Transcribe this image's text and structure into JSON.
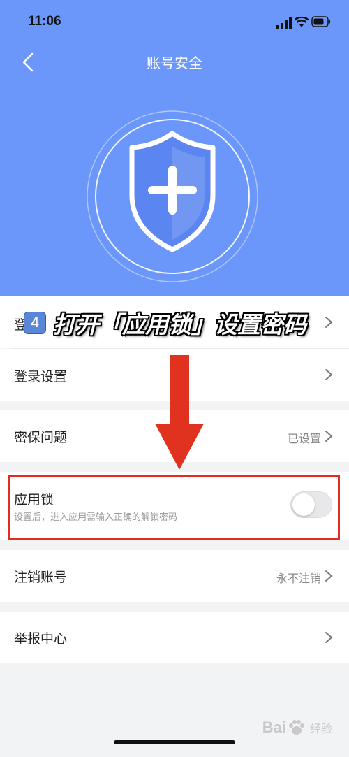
{
  "status_bar": {
    "time": "11:06"
  },
  "header": {
    "title": "账号安全"
  },
  "rows": {
    "login_partial": {
      "label": "登"
    },
    "login_settings": {
      "label": "登录设置"
    },
    "security_question": {
      "label": "密保问题",
      "value": "已设置"
    },
    "app_lock": {
      "label": "应用锁",
      "description": "设置后，进入应用需输入正确的解锁密码",
      "enabled": false
    },
    "cancel_account": {
      "label": "注销账号",
      "value": "永不注销"
    },
    "report_center": {
      "label": "举报中心"
    }
  },
  "annotation": {
    "step": "4",
    "text": "打开「应用锁」设置密码"
  },
  "watermark": {
    "brand": "Bai",
    "sub": "经验"
  },
  "colors": {
    "header_bg": "#6c97fa",
    "highlight": "#e32b1f",
    "arrow": "#e0321f"
  }
}
